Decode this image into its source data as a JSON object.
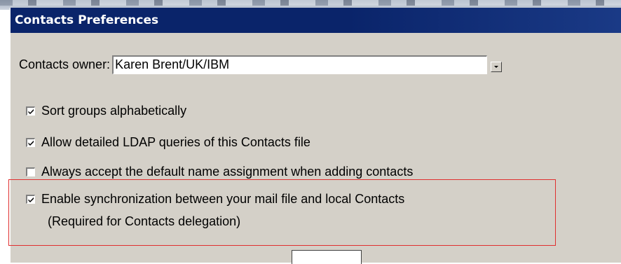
{
  "dialog": {
    "title": "Contacts Preferences"
  },
  "owner": {
    "label": "Contacts owner:",
    "value": "Karen Brent/UK/IBM"
  },
  "options": [
    {
      "label": "Sort groups alphabetically",
      "checked": true
    },
    {
      "label": "Allow detailed LDAP queries of this Contacts file",
      "checked": true
    },
    {
      "label": "Always accept the default name assignment when adding contacts",
      "checked": false
    }
  ],
  "sync": {
    "label": "Enable synchronization between your mail file and local Contacts",
    "note": "(Required for Contacts delegation)",
    "checked": true
  },
  "icons": {
    "dropdown": "chevron-down-icon",
    "check": "check-icon"
  },
  "colors": {
    "titlebar": "#0a246a",
    "dialog_bg": "#d4d0c8",
    "highlight_border": "#e03030"
  }
}
